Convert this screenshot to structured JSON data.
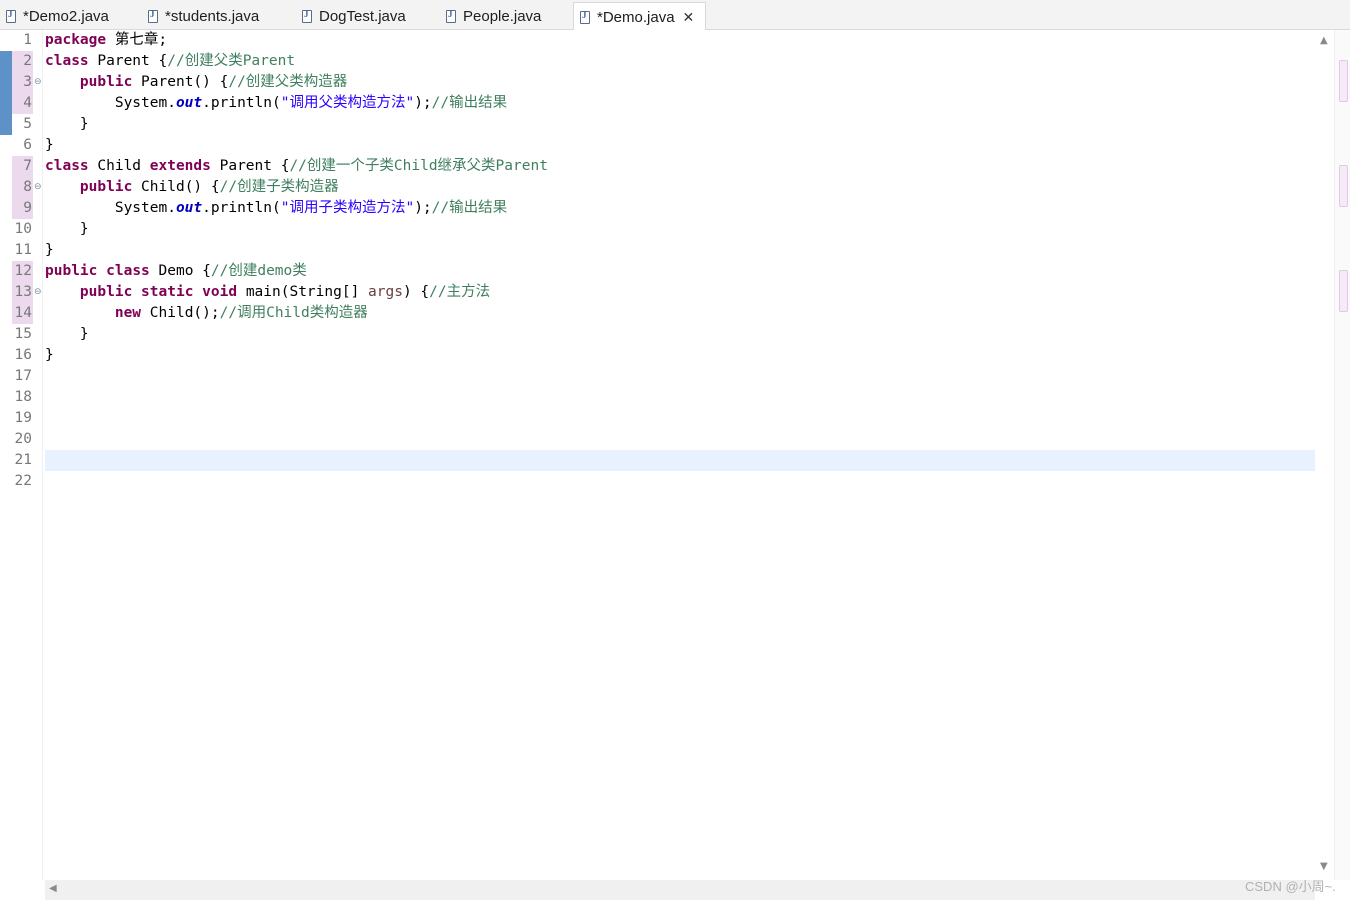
{
  "tabs": [
    {
      "label": "*Demo2.java"
    },
    {
      "label": "*students.java"
    },
    {
      "label": "DogTest.java"
    },
    {
      "label": "People.java"
    },
    {
      "label": "*Demo.java",
      "active": true
    }
  ],
  "editor": {
    "lines": [
      {
        "num": "1"
      },
      {
        "num": "2"
      },
      {
        "num": "3"
      },
      {
        "num": "4"
      },
      {
        "num": "5"
      },
      {
        "num": "6"
      },
      {
        "num": "7"
      },
      {
        "num": "8"
      },
      {
        "num": "9"
      },
      {
        "num": "10"
      },
      {
        "num": "11"
      },
      {
        "num": "12"
      },
      {
        "num": "13"
      },
      {
        "num": "14"
      },
      {
        "num": "15"
      },
      {
        "num": "16"
      },
      {
        "num": "17"
      },
      {
        "num": "18"
      },
      {
        "num": "19"
      },
      {
        "num": "20"
      },
      {
        "num": "21"
      },
      {
        "num": "22"
      }
    ],
    "code": {
      "l1": {
        "kw": "package",
        "rest": " 第七章;"
      },
      "l2": {
        "kw": "class",
        "rest": " Parent {",
        "cm": "//创建父类Parent"
      },
      "l3": {
        "indent": "    ",
        "kw": "public",
        "rest": " Parent() {",
        "cm": "//创建父类构造器"
      },
      "l4": {
        "indent": "        ",
        "pre": "System.",
        "field": "out",
        "mid": ".println(",
        "str": "\"调用父类构造方法\"",
        "post": ");",
        "cm": "//输出结果"
      },
      "l5": {
        "text": "    }"
      },
      "l6": {
        "text": "}"
      },
      "l7": {
        "kw": "class",
        "mid1": " Child ",
        "kw2": "extends",
        "rest": " Parent {",
        "cm": "//创建一个子类Child继承父类Parent"
      },
      "l8": {
        "indent": "    ",
        "kw": "public",
        "rest": " Child() {",
        "cm": "//创建子类构造器"
      },
      "l9": {
        "indent": "        ",
        "pre": "System.",
        "field": "out",
        "mid": ".println(",
        "str": "\"调用子类构造方法\"",
        "post": ");",
        "cm": "//输出结果"
      },
      "l10": {
        "text": "    }"
      },
      "l11": {
        "text": "}"
      },
      "l12": {
        "kw": "public",
        "kw2": "class",
        "rest": " Demo {",
        "cm": "//创建demo类"
      },
      "l13": {
        "indent": "    ",
        "kw": "public",
        "kw2": "static",
        "kw3": "void",
        "mid": " main(String[] ",
        "param": "args",
        "rest": ") {",
        "cm": "//主方法"
      },
      "l14": {
        "indent": "        ",
        "kw": "new",
        "rest": " Child();",
        "cm": "//调用Child类构造器"
      },
      "l15": {
        "text": "    }"
      },
      "l16": {
        "text": "}"
      }
    }
  },
  "colors": {
    "keyword": "#7f0055",
    "comment": "#3f7f5f",
    "string": "#2a00ff",
    "field": "#0000c0",
    "current_line": "#e8f2fe",
    "change_bar": "#5d91c8"
  },
  "icons": {
    "file": "java-file-icon",
    "close": "close-icon",
    "fold": "fold-collapse-icon"
  },
  "watermark": "CSDN @小周~."
}
